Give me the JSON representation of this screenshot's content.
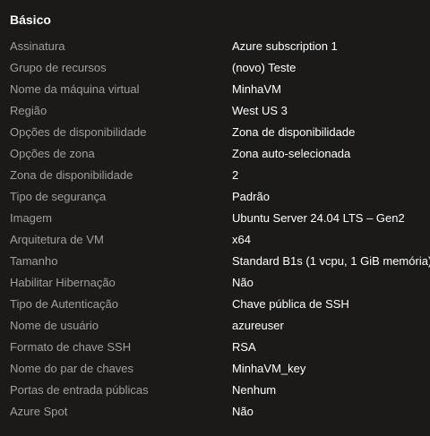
{
  "section": {
    "title": "Básico",
    "rows": [
      {
        "label": "Assinatura",
        "value": "Azure subscription 1"
      },
      {
        "label": "Grupo de recursos",
        "value": "(novo) Teste"
      },
      {
        "label": "Nome da máquina virtual",
        "value": "MinhaVM"
      },
      {
        "label": "Região",
        "value": "West US 3"
      },
      {
        "label": "Opções de disponibilidade",
        "value": "Zona de disponibilidade"
      },
      {
        "label": "Opções de zona",
        "value": "Zona auto-selecionada"
      },
      {
        "label": "Zona de disponibilidade",
        "value": "2"
      },
      {
        "label": "Tipo de segurança",
        "value": "Padrão"
      },
      {
        "label": "Imagem",
        "value": "Ubuntu Server 24.04 LTS – Gen2"
      },
      {
        "label": "Arquitetura de VM",
        "value": "x64"
      },
      {
        "label": "Tamanho",
        "value": "Standard B1s (1 vcpu, 1 GiB memória)"
      },
      {
        "label": "Habilitar Hibernação",
        "value": "Não"
      },
      {
        "label": "Tipo de Autenticação",
        "value": "Chave pública de SSH"
      },
      {
        "label": "Nome de usuário",
        "value": "azureuser"
      },
      {
        "label": "Formato de chave SSH",
        "value": "RSA"
      },
      {
        "label": "Nome do par de chaves",
        "value": "MinhaVM_key"
      },
      {
        "label": "Portas de entrada públicas",
        "value": "Nenhum"
      },
      {
        "label": "Azure Spot",
        "value": "Não"
      }
    ]
  }
}
